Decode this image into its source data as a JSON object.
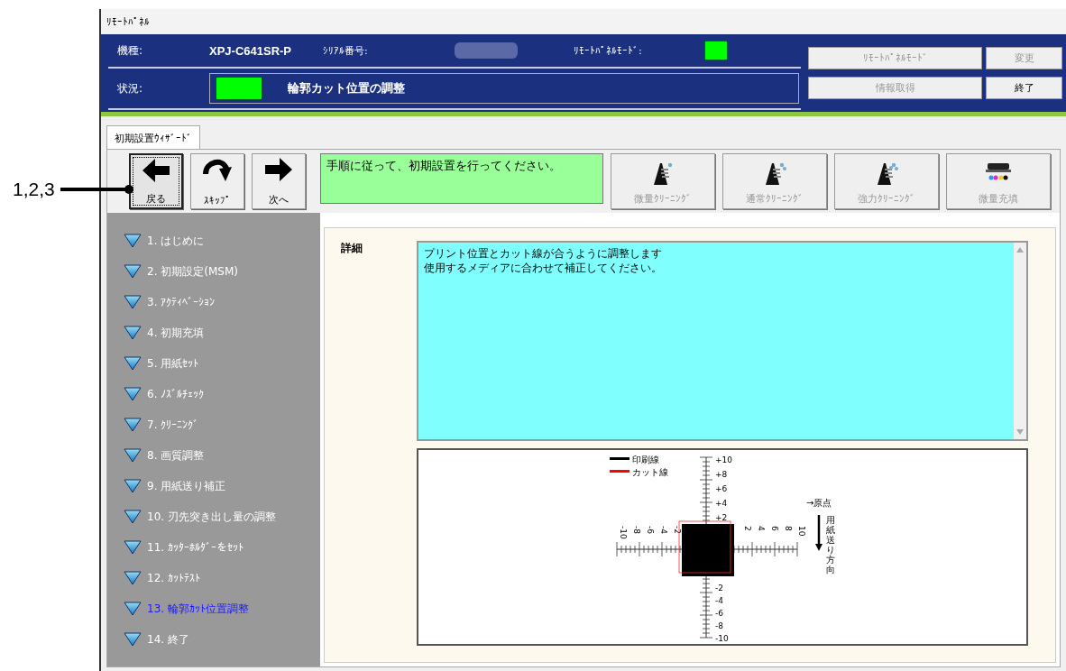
{
  "callout": {
    "label": "1,2,3"
  },
  "window": {
    "title": "ﾘﾓｰﾄﾊﾟﾈﾙ"
  },
  "header": {
    "model_label": "機種:",
    "model_value": "XPJ-C641SR-P",
    "serial_label": "ｼﾘｱﾙ番号:",
    "remote_mode_label": "ﾘﾓｰﾄﾊﾟﾈﾙﾓｰﾄﾞ:",
    "status_label": "状況:",
    "status_text": "輪郭カット位置の調整",
    "buttons": [
      {
        "label": "ﾘﾓｰﾄﾊﾟﾈﾙﾓｰﾄﾞ",
        "disabled": true,
        "wide": true
      },
      {
        "label": "変更",
        "disabled": true,
        "wide": false
      },
      {
        "label": "情報取得",
        "disabled": true,
        "wide": true
      },
      {
        "label": "終了",
        "disabled": false,
        "wide": false
      }
    ]
  },
  "tabs": [
    {
      "label": "初期設置ｳｨｻﾞｰﾄﾞ",
      "selected": true
    }
  ],
  "nav_buttons": [
    {
      "kind": "back",
      "label": "戻る",
      "focused": true
    },
    {
      "kind": "skip",
      "label": "ｽｷｯﾌﾟ",
      "focused": false
    },
    {
      "kind": "next",
      "label": "次へ",
      "focused": false
    }
  ],
  "message": "手順に従って、初期設置を行ってください。",
  "tool_buttons": [
    {
      "kind": "clean1",
      "label": "微量ｸﾘｰﾆﾝｸﾞ",
      "disabled": true
    },
    {
      "kind": "clean2",
      "label": "通常ｸﾘｰﾆﾝｸﾞ",
      "disabled": true
    },
    {
      "kind": "clean3",
      "label": "強力ｸﾘｰﾆﾝｸﾞ",
      "disabled": true
    },
    {
      "kind": "fill",
      "label": "微量充填",
      "disabled": true
    }
  ],
  "steps": [
    {
      "label": "1. はじめに",
      "selected": false
    },
    {
      "label": "2. 初期設定(MSM)",
      "selected": false
    },
    {
      "label": "3. ｱｸﾃｨﾍﾞｰｼｮﾝ",
      "selected": false
    },
    {
      "label": "4. 初期充填",
      "selected": false
    },
    {
      "label": "5. 用紙ｾｯﾄ",
      "selected": false
    },
    {
      "label": "6. ﾉｽﾞﾙﾁｪｯｸ",
      "selected": false
    },
    {
      "label": "7. ｸﾘｰﾆﾝｸﾞ",
      "selected": false
    },
    {
      "label": "8. 画質調整",
      "selected": false
    },
    {
      "label": "9. 用紙送り補正",
      "selected": false
    },
    {
      "label": "10. 刃先突き出し量の調整",
      "selected": false
    },
    {
      "label": "11. ｶｯﾀｰﾎﾙﾀﾞｰをｾｯﾄ",
      "selected": false
    },
    {
      "label": "12. ｶｯﾄﾃｽﾄ",
      "selected": false
    },
    {
      "label": "13. 輪郭ｶｯﾄ位置調整",
      "selected": true
    },
    {
      "label": "14. 終了",
      "selected": false
    }
  ],
  "detail": {
    "label": "詳細",
    "text_lines": [
      "プリント位置とカット線が合うように調整します",
      "使用するメディアに合わせて補正してください。"
    ]
  },
  "diagram": {
    "legend": [
      {
        "label": "印刷線",
        "color": "#000000"
      },
      {
        "label": "カット線",
        "color": "#ff0000"
      }
    ],
    "vertical_labels": [
      "+10",
      "+8",
      "+6",
      "+4",
      "+2",
      "-2",
      "-4",
      "-6",
      "-8",
      "-10"
    ],
    "horizontal_labels": [
      "-10",
      "-8",
      "-6",
      "-4",
      "-2",
      "2",
      "4",
      "6",
      "8",
      "10"
    ],
    "origin_label": "→原点",
    "feed_label": "用紙送り方向"
  }
}
